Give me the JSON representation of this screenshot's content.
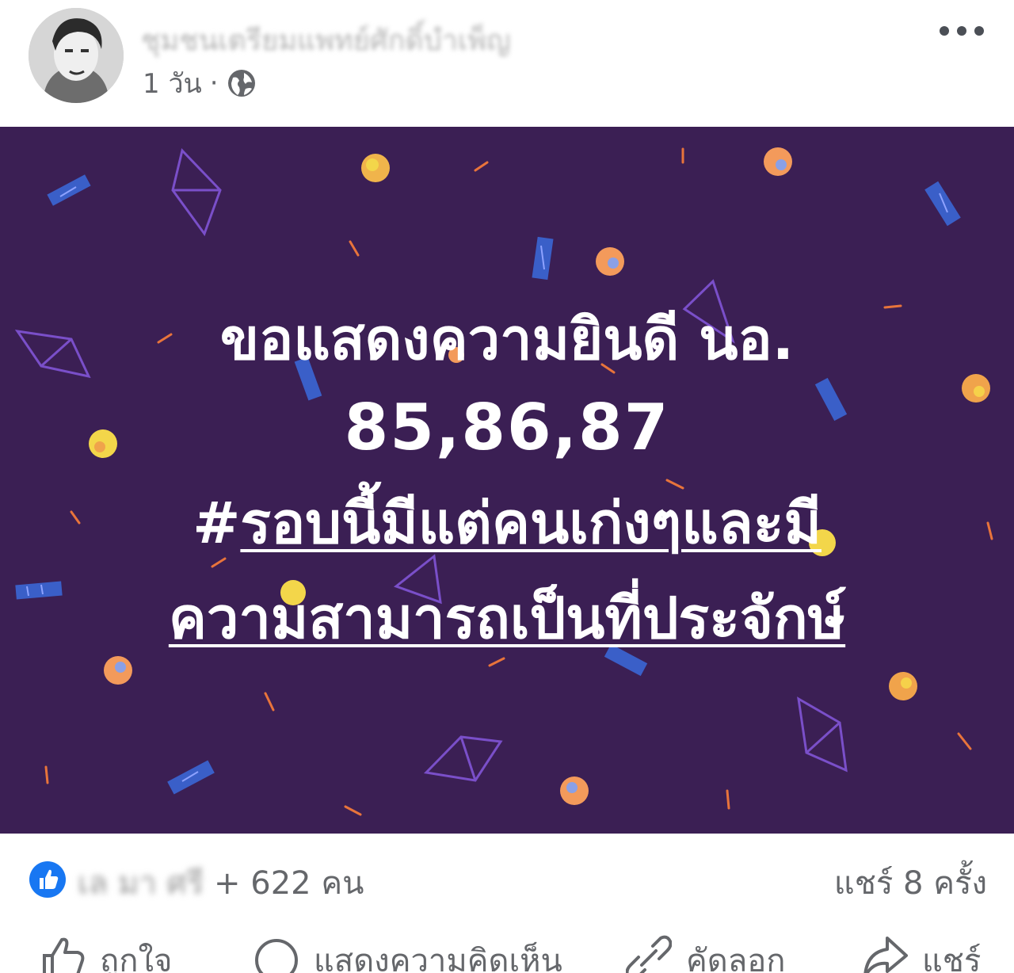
{
  "post": {
    "author_name": "ชุมชนเตรียมแพทย์ศักดิ์บำเพ็ญ",
    "time": "1 วัน",
    "separator": "·",
    "privacy_icon": "globe-icon",
    "more_icon": "more-dots-icon"
  },
  "banner": {
    "background_color": "#3b1f54",
    "line1": "ขอแสดงความยินดี นอ.",
    "line2": "85,86,87",
    "line3_hash": "#",
    "line3_text": "รอบนี้มีแต่คนเก่งๆและมี",
    "line4": "ความสามารถเป็นที่ประจักษ์"
  },
  "stats": {
    "reactors_blurred": "เล มา ศรี",
    "reactors_count": "+ 622 คน",
    "shares": "แชร์ 8 ครั้ง"
  },
  "actions": {
    "like": "ถูกใจ",
    "comment": "แสดงความคิดเห็น",
    "copy": "คัดลอก",
    "share": "แชร์"
  },
  "colors": {
    "accent": "#1877f2",
    "text_secondary": "#65676b"
  }
}
